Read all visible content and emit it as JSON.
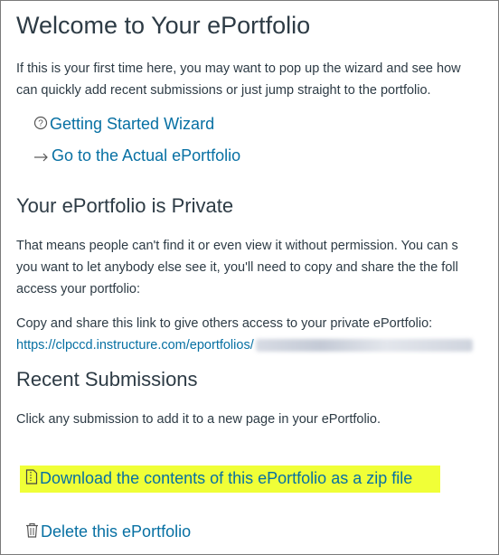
{
  "header": {
    "title": "Welcome to Your ePortfolio"
  },
  "intro": {
    "line1": "If this is your first time here, you may want to pop up the wizard and see how",
    "line2": "can quickly add recent submissions or just jump straight to the portfolio."
  },
  "links": {
    "wizard": "Getting Started Wizard",
    "actual": "Go to the Actual ePortfolio"
  },
  "private_section": {
    "title": "Your ePortfolio is Private",
    "line1": "That means people can't find it or even view it without permission. You can s",
    "line2": "you want to let anybody else see it, you'll need to copy and share the the foll",
    "line3": "access your portfolio:",
    "share_label": "Copy and share this link to give others access to your private ePortfolio:",
    "share_url": "https://clpccd.instructure.com/eportfolios/"
  },
  "submissions": {
    "title": "Recent Submissions",
    "text": "Click any submission to add it to a new page in your ePortfolio."
  },
  "actions": {
    "download": "Download the contents of this ePortfolio as a zip file",
    "delete": "Delete this ePortfolio"
  },
  "colors": {
    "link": "#0770a3",
    "text": "#2d3b45",
    "highlight": "#f0ff37"
  }
}
